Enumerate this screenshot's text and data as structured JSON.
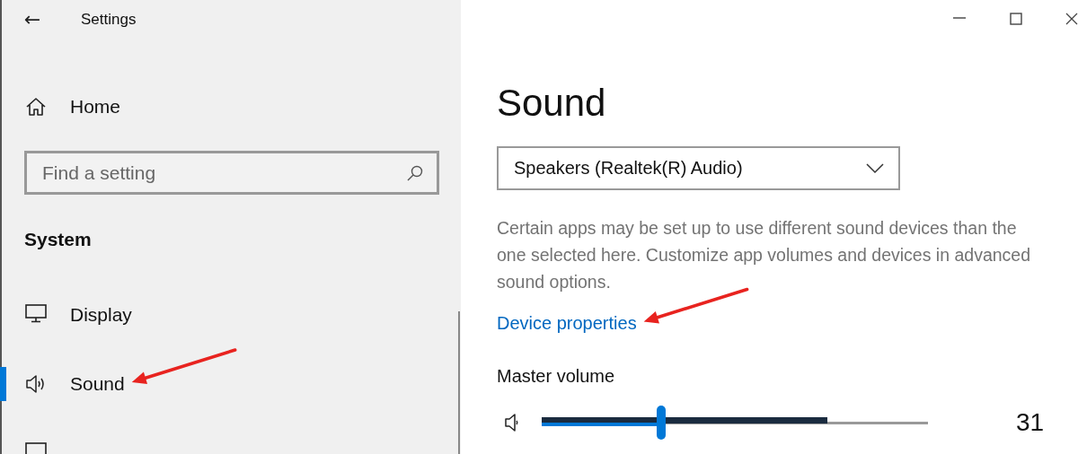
{
  "window": {
    "title": "Settings",
    "back_button": "←"
  },
  "sidebar": {
    "home": {
      "label": "Home"
    },
    "search": {
      "placeholder": "Find a setting"
    },
    "section": "System",
    "items": [
      {
        "label": "Display",
        "kind": "display",
        "selected": false,
        "arrow": false
      },
      {
        "label": "Sound",
        "kind": "sound",
        "selected": true,
        "arrow": true
      },
      {
        "kind": "display",
        "selected": false,
        "arrow": false
      }
    ]
  },
  "page": {
    "title": "Sound",
    "device_dropdown": {
      "value": "Speakers (Realtek(R) Audio)"
    },
    "description": "Certain apps may be set up to use different sound devices than the one selected here. Customize app volumes and devices in advanced sound options.",
    "link": {
      "label": "Device properties",
      "arrow": true
    },
    "volume": {
      "label": "Master volume",
      "level": 0.31,
      "reading": "31"
    },
    "meter": {
      "level": 0.74
    }
  }
}
